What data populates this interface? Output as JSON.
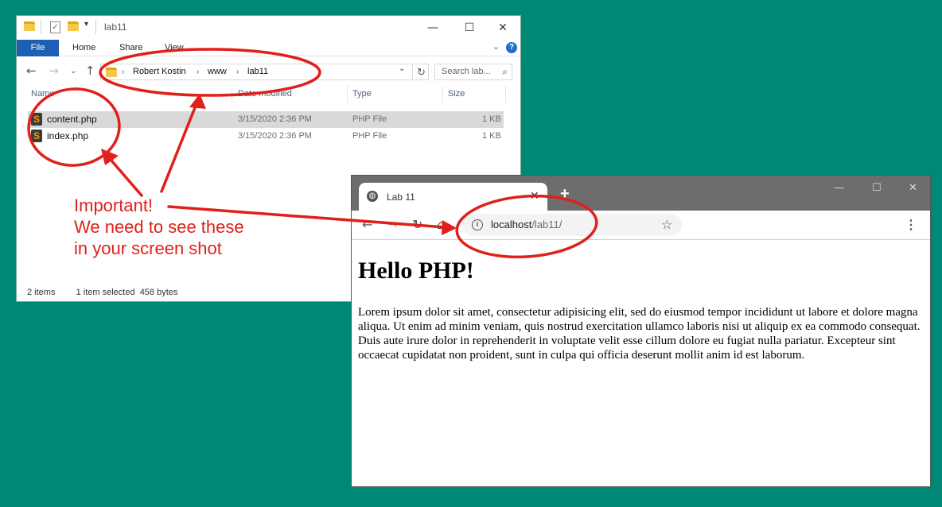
{
  "explorer": {
    "title": "lab11",
    "window_controls": {
      "minimize": "—",
      "maximize": "☐",
      "close": "✕"
    },
    "ribbon": {
      "file": "File",
      "home": "Home",
      "share": "Share",
      "view": "View"
    },
    "breadcrumb": [
      "Robert Kostin",
      "www",
      "lab11"
    ],
    "search_placeholder": "Search lab...",
    "columns": {
      "name": "Name",
      "date": "Date modified",
      "type": "Type",
      "size": "Size"
    },
    "files": [
      {
        "name": "content.php",
        "date": "3/15/2020 2:36 PM",
        "type": "PHP File",
        "size": "1 KB",
        "selected": true
      },
      {
        "name": "index.php",
        "date": "3/15/2020 2:36 PM",
        "type": "PHP File",
        "size": "1 KB",
        "selected": false
      }
    ],
    "status": {
      "items": "2 items",
      "selection": "1 item selected  458 bytes"
    }
  },
  "browser": {
    "tab_title": "Lab 11",
    "new_tab": "+",
    "url_host": "localhost",
    "url_path": "/lab11/",
    "page_heading": "Hello PHP!",
    "page_text": "Lorem ipsum dolor sit amet, consectetur adipisicing elit, sed do eiusmod tempor incididunt ut labore et dolore magna aliqua. Ut enim ad minim veniam, quis nostrud exercitation ullamco laboris nisi ut aliquip ex ea commodo consequat. Duis aute irure dolor in reprehenderit in voluptate velit esse cillum dolore eu fugiat nulla pariatur. Excepteur sint occaecat cupidatat non proident, sunt in culpa qui officia deserunt mollit anim id est laborum."
  },
  "annotation": {
    "lines": [
      "Important!",
      "We need to see these",
      "in your screen shot"
    ],
    "color": "#e0201b"
  },
  "colors": {
    "desktop": "#008877",
    "ribbon_file": "#1f5fb3",
    "chrome_frame": "#6d6d6d"
  }
}
